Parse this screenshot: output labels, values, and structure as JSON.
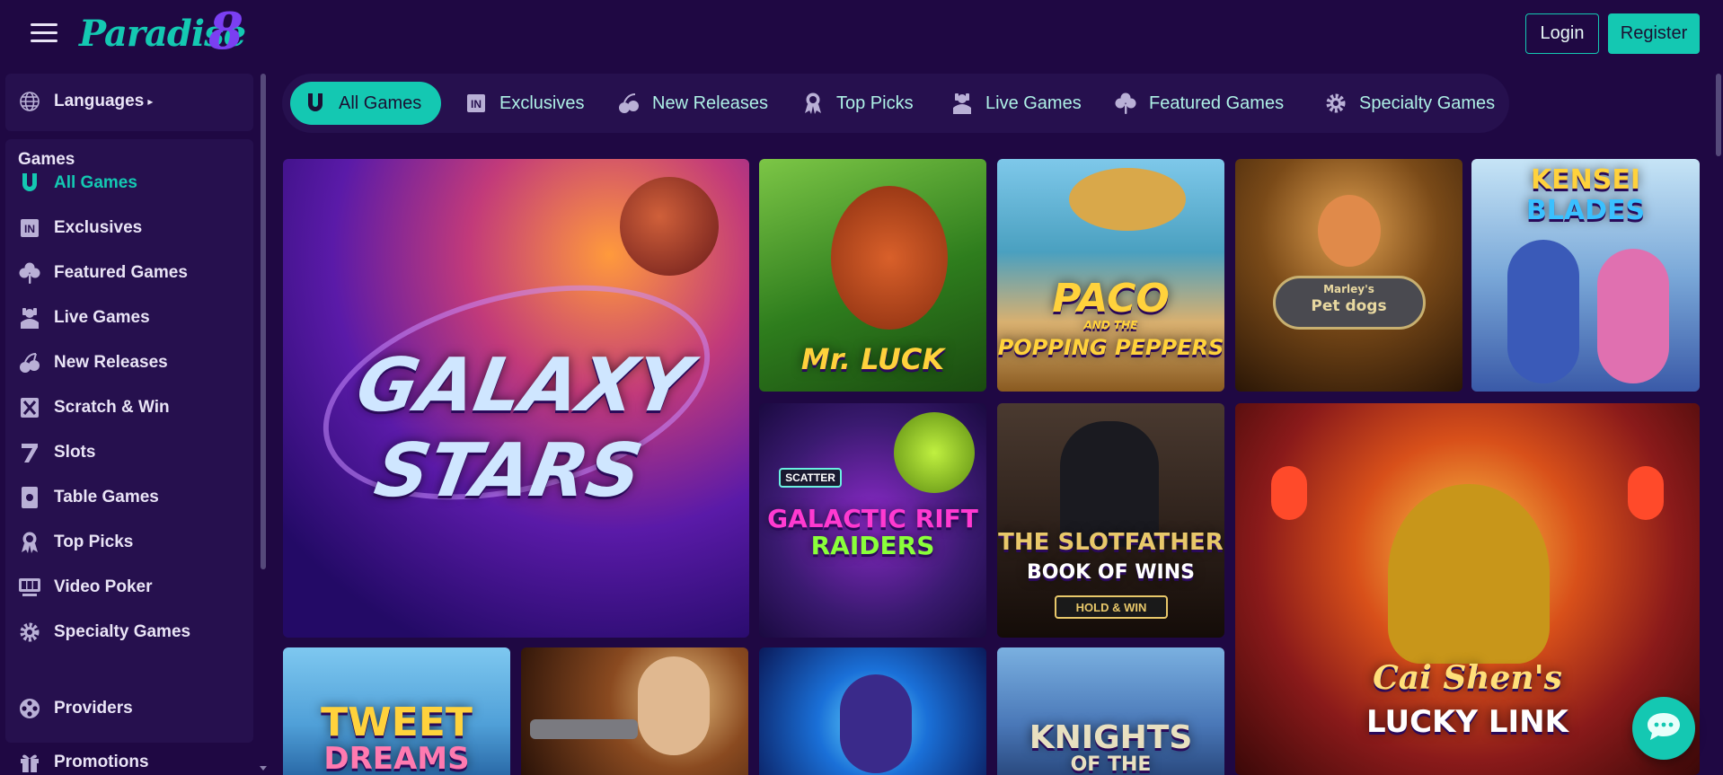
{
  "header": {
    "logo_text": "Paradise",
    "logo_number": "8",
    "login_label": "Login",
    "register_label": "Register"
  },
  "sidebar": {
    "languages_label": "Languages",
    "games_heading": "Games",
    "items": [
      {
        "label": "All Games",
        "icon": "horseshoe-icon",
        "active": true
      },
      {
        "label": "Exclusives",
        "icon": "exclusive-badge-icon"
      },
      {
        "label": "Featured Games",
        "icon": "clover-icon"
      },
      {
        "label": "Live Games",
        "icon": "dealer-icon"
      },
      {
        "label": "New Releases",
        "icon": "cherries-icon"
      },
      {
        "label": "Scratch & Win",
        "icon": "scratch-ticket-icon"
      },
      {
        "label": "Slots",
        "icon": "seven-icon"
      },
      {
        "label": "Table Games",
        "icon": "card-table-icon"
      },
      {
        "label": "Top Picks",
        "icon": "award-ribbon-icon"
      },
      {
        "label": "Video Poker",
        "icon": "poker-machine-icon"
      },
      {
        "label": "Specialty Games",
        "icon": "gear-icon"
      }
    ],
    "providers_label": "Providers",
    "promotions_label": "Promotions"
  },
  "tabs": [
    {
      "label": "All Games",
      "icon": "horseshoe-icon",
      "active": true
    },
    {
      "label": "Exclusives",
      "icon": "exclusive-badge-icon"
    },
    {
      "label": "New Releases",
      "icon": "cherries-icon"
    },
    {
      "label": "Top Picks",
      "icon": "award-ribbon-icon"
    },
    {
      "label": "Live Games",
      "icon": "dealer-icon"
    },
    {
      "label": "Featured Games",
      "icon": "clover-icon"
    },
    {
      "label": "Specialty Games",
      "icon": "gear-icon"
    }
  ],
  "games": {
    "galaxy_stars": "GALAXY STARS",
    "mr_luck": "Mr. LUCK",
    "paco_line1": "PACO",
    "paco_line2": "AND THE",
    "paco_line3": "POPPING PEPPERS",
    "marleys_line1": "Marley's",
    "marleys_line2": "Pet dogs",
    "kensei_line1": "KENSEI",
    "kensei_line2": "BLADES",
    "galactic_badge": "SCATTER",
    "galactic_line1": "GALACTIC RIFT",
    "galactic_line2": "RAIDERS",
    "slotfather_line1": "THE SLOTFATHER",
    "slotfather_line2": "BOOK OF WINS",
    "slotfather_line3": "HOLD & WIN",
    "caishen_line1": "Cai Shen's",
    "caishen_line2": "LUCKY LINK",
    "tweet_line1": "TWEET",
    "tweet_line2": "DREAMS",
    "knights_line1": "KNIGHTS",
    "knights_line2": "OF THE"
  },
  "colors": {
    "background": "#1f0843",
    "panel": "#26104e",
    "accent": "#14c8b2",
    "logo_purple": "#7b3ff2"
  }
}
